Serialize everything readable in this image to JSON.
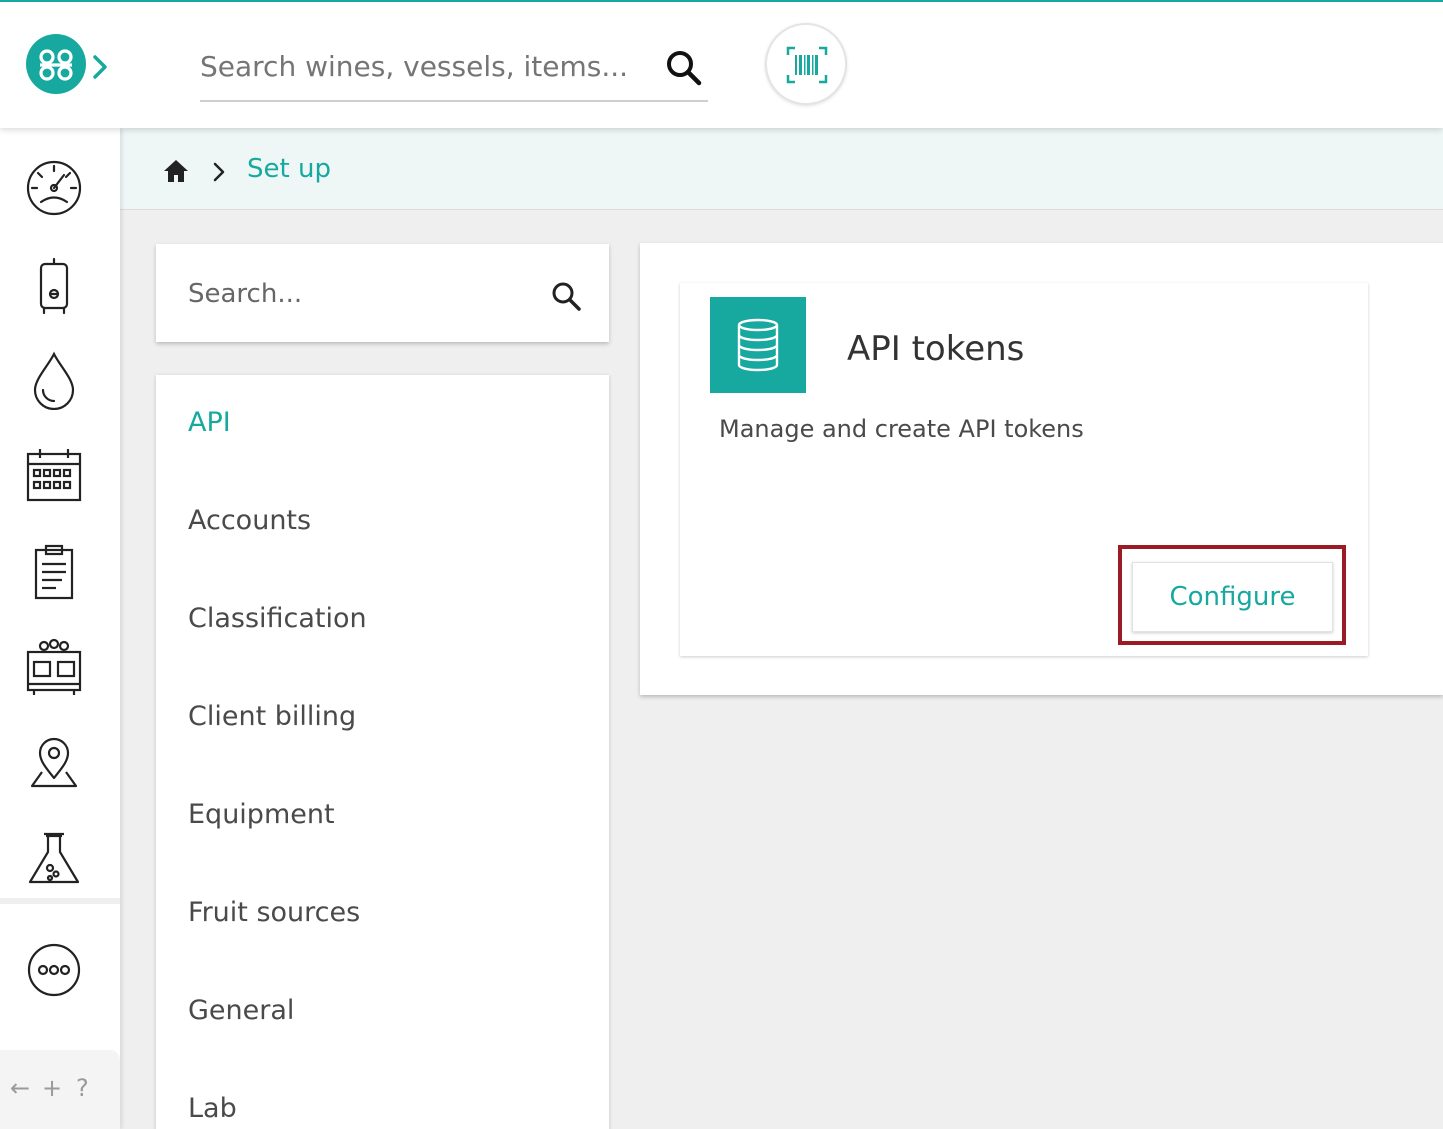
{
  "header": {
    "search_placeholder": "Search wines, vessels, items..."
  },
  "rail": {
    "items": [
      {
        "icon": "dashboard-gauge-icon"
      },
      {
        "icon": "vessel-tank-icon"
      },
      {
        "icon": "drop-icon"
      },
      {
        "icon": "calendar-icon"
      },
      {
        "icon": "clipboard-icon"
      },
      {
        "icon": "barrels-icon"
      },
      {
        "icon": "map-pin-icon"
      },
      {
        "icon": "lab-flask-icon"
      },
      {
        "icon": "more-icon"
      }
    ],
    "footer": {
      "back": "←",
      "add": "+",
      "help": "?"
    }
  },
  "breadcrumb": {
    "current": "Set up"
  },
  "settings_search": {
    "placeholder": "Search..."
  },
  "categories": [
    {
      "label": "API",
      "active": true
    },
    {
      "label": "Accounts"
    },
    {
      "label": "Classification"
    },
    {
      "label": "Client billing"
    },
    {
      "label": "Equipment"
    },
    {
      "label": "Fruit sources"
    },
    {
      "label": "General"
    },
    {
      "label": "Lab"
    }
  ],
  "card": {
    "icon": "database-icon",
    "title": "API tokens",
    "description": "Manage and create API tokens",
    "button_label": "Configure"
  },
  "colors": {
    "accent": "#17a99f",
    "highlight": "#9b1b24"
  }
}
